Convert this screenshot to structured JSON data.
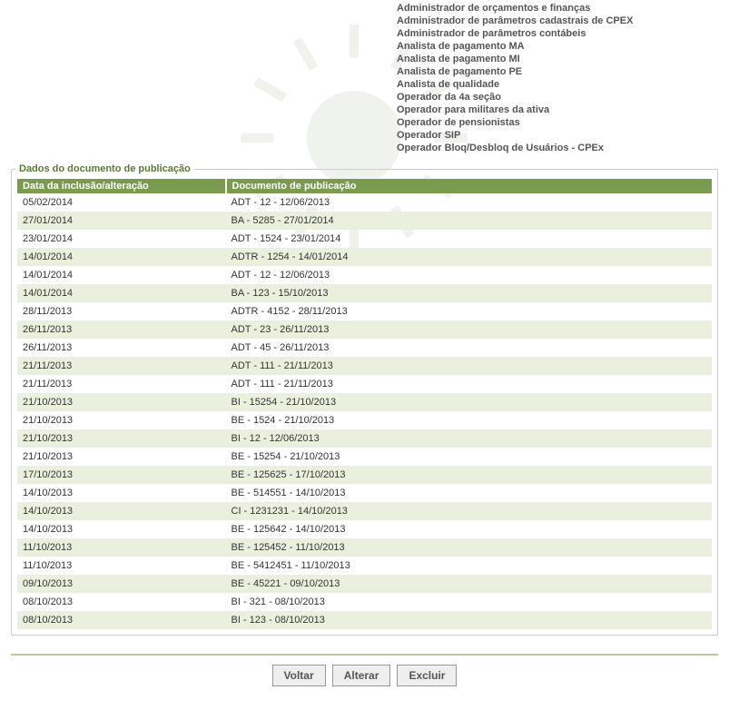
{
  "roles": [
    "Administrador de orçamentos e finanças",
    "Administrador de parâmetros cadastrais de CPEX",
    "Administrador de parâmetros contábeis",
    "Analista de pagamento MA",
    "Analista de pagamento MI",
    "Analista de pagamento PE",
    "Analista de qualidade",
    "Operador da 4a seção",
    "Operador para militares da ativa",
    "Operador de pensionistas",
    "Operador SIP",
    "Operador Bloq/Desbloq de Usuários - CPEx"
  ],
  "section": {
    "title": "Dados do documento de publicação",
    "columns": {
      "date": "Data da inclusão/alteração",
      "doc": "Documento de publicação"
    }
  },
  "rows": [
    {
      "date": "05/02/2014",
      "doc": "ADT - 12 - 12/06/2013"
    },
    {
      "date": "27/01/2014",
      "doc": "BA - 5285 - 27/01/2014"
    },
    {
      "date": "23/01/2014",
      "doc": "ADT - 1524 - 23/01/2014"
    },
    {
      "date": "14/01/2014",
      "doc": "ADTR - 1254 - 14/01/2014"
    },
    {
      "date": "14/01/2014",
      "doc": "ADT - 12 - 12/06/2013"
    },
    {
      "date": "14/01/2014",
      "doc": "BA - 123 - 15/10/2013"
    },
    {
      "date": "28/11/2013",
      "doc": "ADTR - 4152 - 28/11/2013"
    },
    {
      "date": "26/11/2013",
      "doc": "ADT - 23 - 26/11/2013"
    },
    {
      "date": "26/11/2013",
      "doc": "ADT - 45 - 26/11/2013"
    },
    {
      "date": "21/11/2013",
      "doc": "ADT - 111 - 21/11/2013"
    },
    {
      "date": "21/11/2013",
      "doc": "ADT - 111 - 21/11/2013"
    },
    {
      "date": "21/10/2013",
      "doc": "BI - 15254 - 21/10/2013"
    },
    {
      "date": "21/10/2013",
      "doc": "BE - 1524 - 21/10/2013"
    },
    {
      "date": "21/10/2013",
      "doc": "BI - 12 - 12/06/2013"
    },
    {
      "date": "21/10/2013",
      "doc": "BE - 15254 - 21/10/2013"
    },
    {
      "date": "17/10/2013",
      "doc": "BE - 125625 - 17/10/2013"
    },
    {
      "date": "14/10/2013",
      "doc": "BE - 514551 - 14/10/2013"
    },
    {
      "date": "14/10/2013",
      "doc": "CI - 1231231 - 14/10/2013"
    },
    {
      "date": "14/10/2013",
      "doc": "BE - 125642 - 14/10/2013"
    },
    {
      "date": "11/10/2013",
      "doc": "BE - 125452 - 11/10/2013"
    },
    {
      "date": "11/10/2013",
      "doc": "BE - 5412451 - 11/10/2013"
    },
    {
      "date": "09/10/2013",
      "doc": "BE - 45221 - 09/10/2013"
    },
    {
      "date": "08/10/2013",
      "doc": "BI - 321 - 08/10/2013"
    },
    {
      "date": "08/10/2013",
      "doc": "BI - 123 - 08/10/2013"
    }
  ],
  "buttons": {
    "back": "Voltar",
    "edit": "Alterar",
    "delete": "Excluir"
  }
}
